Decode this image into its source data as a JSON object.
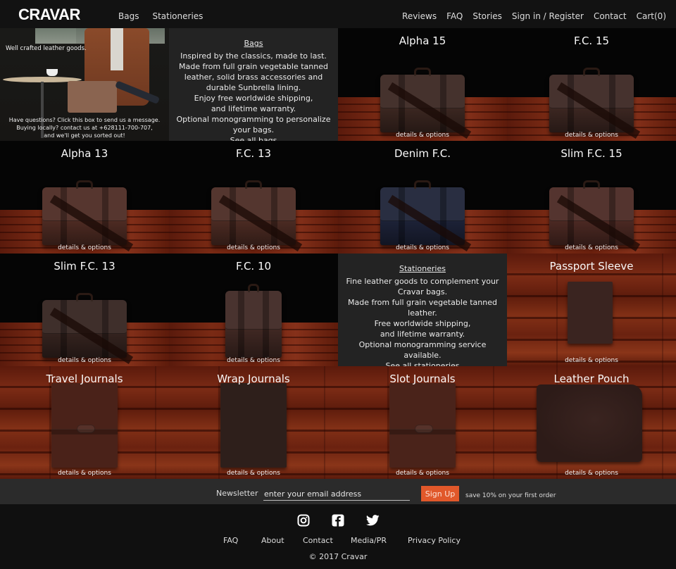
{
  "header": {
    "logo": "CRAVAR",
    "nav_left": [
      "Bags",
      "Stationeries"
    ],
    "nav_right": [
      "Reviews",
      "FAQ",
      "Stories",
      "Sign in / Register",
      "Contact",
      "Cart(0)"
    ]
  },
  "hero": {
    "tagline": "Well crafted leather goods.",
    "message_lines": [
      "Have questions? Click this box to send us a message.",
      "Buying locally? contact us at +628111-700-707,",
      "and we'll get you sorted out!"
    ]
  },
  "bags_info": {
    "title": "Bags",
    "lines": [
      "Inspired by the classics, made to last.",
      "Made from full grain vegetable tanned leather, solid brass accessories and durable Sunbrella lining.",
      "Enjoy free worldwide shipping,",
      "and lifetime warranty.",
      "Optional monogramming to personalize your bags."
    ],
    "link": "See all bags"
  },
  "stationeries_info": {
    "title": "Stationeries",
    "lines": [
      "Fine leather goods to complement your Cravar bags.",
      "Made from full grain vegetable tanned leather.",
      "Free worldwide shipping,",
      "and lifetime warranty.",
      "Optional monogramming service available."
    ],
    "link": "See all stationeries"
  },
  "products": [
    {
      "name": "Alpha 15",
      "link": "details & options",
      "color": "#3a2620",
      "kind": "bag"
    },
    {
      "name": "F.C. 15",
      "link": "details & options",
      "color": "#3b2621",
      "kind": "bag"
    },
    {
      "name": "Alpha 13",
      "link": "details & options",
      "color": "#4c2a22",
      "kind": "bag"
    },
    {
      "name": "F.C. 13",
      "link": "details & options",
      "color": "#4a2a22",
      "kind": "bag"
    },
    {
      "name": "Denim F.C.",
      "link": "details & options",
      "color": "#1c2136",
      "kind": "bag"
    },
    {
      "name": "Slim F.C. 15",
      "link": "details & options",
      "color": "#4a2822",
      "kind": "bag"
    },
    {
      "name": "Slim F.C. 13",
      "link": "details & options",
      "color": "#33221e",
      "kind": "bag"
    },
    {
      "name": "F.C. 10",
      "link": "details & options",
      "color": "#3e2722",
      "kind": "bag"
    },
    {
      "name": "Passport Sleeve",
      "link": "details & options",
      "color": "#3a2420",
      "kind": "small"
    },
    {
      "name": "Travel Journals",
      "link": "details & options",
      "color": "#4a2219",
      "kind": "journal"
    },
    {
      "name": "Wrap Journals",
      "link": "details & options",
      "color": "#2e1f1b",
      "kind": "journal"
    },
    {
      "name": "Slot Journals",
      "link": "details & options",
      "color": "#4a231a",
      "kind": "journal"
    },
    {
      "name": "Leather Pouch",
      "link": "details & options",
      "color": "#2d1b18",
      "kind": "pouch"
    }
  ],
  "newsletter": {
    "label": "Newsletter",
    "placeholder": "enter your email address",
    "value": "",
    "button": "Sign Up",
    "note": "save 10% on your first order",
    "accent": "#e1582a"
  },
  "footer": {
    "social": [
      "instagram-icon",
      "facebook-icon",
      "twitter-icon"
    ],
    "links": [
      "FAQ",
      "About",
      "Contact",
      "Media/PR",
      "Privacy Policy"
    ],
    "copyright": "© 2017 Cravar"
  }
}
